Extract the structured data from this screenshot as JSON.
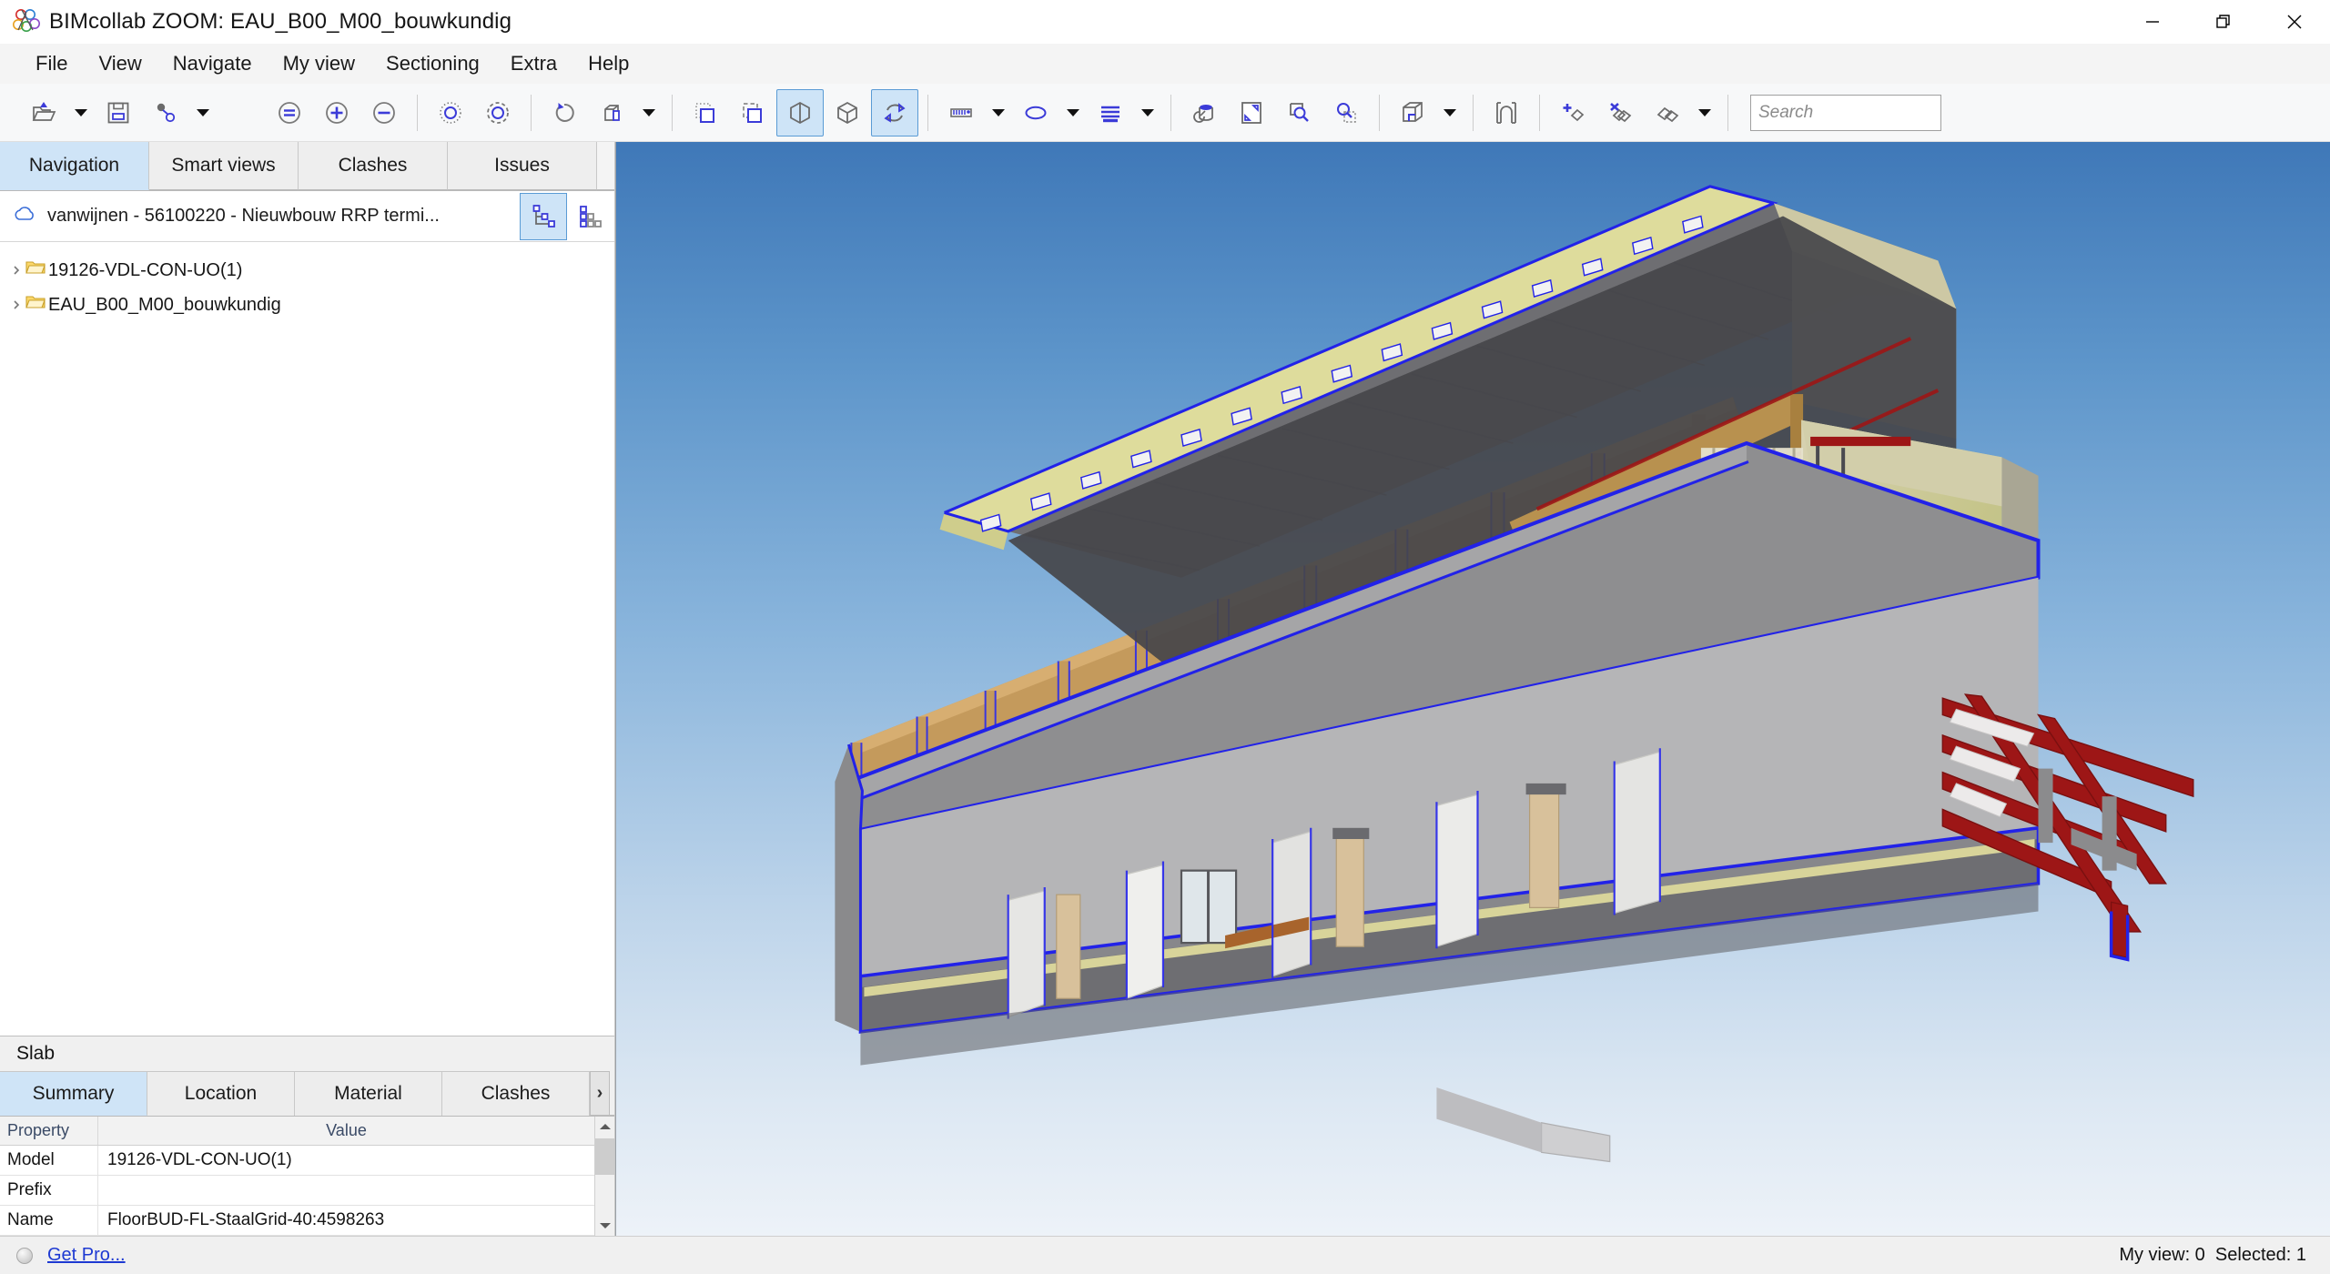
{
  "window": {
    "title": "BIMcollab ZOOM: EAU_B00_M00_bouwkundig",
    "logo_icon": "bimcollab-logo-icon",
    "controls": {
      "minimize": "minimize-icon",
      "restore": "restore-icon",
      "close": "close-icon"
    }
  },
  "menubar": {
    "items": [
      {
        "label": "File"
      },
      {
        "label": "View"
      },
      {
        "label": "Navigate"
      },
      {
        "label": "My view"
      },
      {
        "label": "Sectioning"
      },
      {
        "label": "Extra"
      },
      {
        "label": "Help"
      }
    ]
  },
  "toolbar": {
    "buttons": [
      {
        "name": "open-model-icon",
        "has_dropdown": true,
        "active": false
      },
      {
        "name": "save-icon",
        "has_dropdown": false,
        "active": false
      },
      {
        "name": "link-node-icon",
        "has_dropdown": true,
        "active": false
      },
      {
        "name": "zoom-fit-icon",
        "has_dropdown": false,
        "active": false
      },
      {
        "name": "zoom-in-icon",
        "has_dropdown": false,
        "active": false
      },
      {
        "name": "zoom-out-icon",
        "has_dropdown": false,
        "active": false
      },
      {
        "name": "select-point-icon",
        "has_dropdown": false,
        "active": false
      },
      {
        "name": "select-area-icon",
        "has_dropdown": false,
        "active": false
      },
      {
        "name": "undo-icon",
        "has_dropdown": false,
        "active": false
      },
      {
        "name": "isolate-objects-icon",
        "has_dropdown": true,
        "active": false
      },
      {
        "name": "marquee-select-icon",
        "has_dropdown": false,
        "active": false
      },
      {
        "name": "crossing-select-icon",
        "has_dropdown": false,
        "active": false
      },
      {
        "name": "section-view-icon",
        "has_dropdown": false,
        "active": true
      },
      {
        "name": "box-view-icon",
        "has_dropdown": false,
        "active": false
      },
      {
        "name": "orbit-icon",
        "has_dropdown": false,
        "active": true
      },
      {
        "name": "measure-icon",
        "has_dropdown": true,
        "active": false
      },
      {
        "name": "ellipse-icon",
        "has_dropdown": true,
        "active": false
      },
      {
        "name": "layers-icon",
        "has_dropdown": true,
        "active": false
      },
      {
        "name": "paint-bucket-icon",
        "has_dropdown": false,
        "active": false
      },
      {
        "name": "fit-to-screen-icon",
        "has_dropdown": false,
        "active": false
      },
      {
        "name": "zoom-window-icon",
        "has_dropdown": false,
        "active": false
      },
      {
        "name": "zoom-selection-icon",
        "has_dropdown": false,
        "active": false
      },
      {
        "name": "cube-corner-icon",
        "has_dropdown": true,
        "active": false
      },
      {
        "name": "clip-plane-icon",
        "has_dropdown": false,
        "active": false
      },
      {
        "name": "add-element-icon",
        "has_dropdown": false,
        "active": false
      },
      {
        "name": "remove-element-icon",
        "has_dropdown": false,
        "active": false
      },
      {
        "name": "hide-element-icon",
        "has_dropdown": true,
        "active": false
      }
    ],
    "search": {
      "value": "",
      "placeholder": "Search"
    }
  },
  "left_panel": {
    "tabs": [
      {
        "label": "Navigation",
        "active": true
      },
      {
        "label": "Smart views",
        "active": false
      },
      {
        "label": "Clashes",
        "active": false
      },
      {
        "label": "Issues",
        "active": false
      }
    ],
    "project": {
      "icon": "cloud-icon",
      "name": "vanwijnen - 56100220 - Nieuwbouw RRP termi...",
      "tree_view_button": "tree-structure-icon",
      "grid_view_button": "grid-matrix-icon"
    },
    "tree_items": [
      {
        "label": "19126-VDL-CON-UO(1)",
        "icon": "folder-icon",
        "expanded": false
      },
      {
        "label": "EAU_B00_M00_bouwkundig",
        "icon": "folder-icon",
        "expanded": false
      }
    ]
  },
  "properties_panel": {
    "header": "Slab",
    "tabs": [
      {
        "label": "Summary",
        "active": true
      },
      {
        "label": "Location",
        "active": false
      },
      {
        "label": "Material",
        "active": false
      },
      {
        "label": "Clashes",
        "active": false
      }
    ],
    "scroll_next": "›",
    "columns": {
      "property": "Property",
      "value": "Value"
    },
    "rows": [
      {
        "property": "Model",
        "value": "19126-VDL-CON-UO(1)"
      },
      {
        "property": "Prefix",
        "value": ""
      },
      {
        "property": "Name",
        "value": "FloorBUD-FL-StaalGrid-40:4598263"
      }
    ]
  },
  "statusbar": {
    "indicator": "status-dot-icon",
    "get_pro": "Get Pro...",
    "my_view_label": "My view: 0  Selected: 1"
  },
  "viewport": {
    "name": "3d-model-viewport",
    "model_title": "EAU_B00_M00_bouwkundig",
    "colors": {
      "sky_top": "#3f78b8",
      "sky_bottom": "#eef3f9",
      "timber": "#c49a5c",
      "timber_dark": "#a87f45",
      "wall_white": "#f4f4f2",
      "wall_grey": "#b9b9bb",
      "slab_grey": "#8e8e90",
      "selection_blue": "#2222e8",
      "steel_red": "#9d1616",
      "insulation_yellow": "#e8e59a",
      "olive": "#c3c487",
      "glass": "#dfe6ea",
      "roof_dark": "#4a4a4d",
      "door_tan": "#d8c19b"
    }
  }
}
